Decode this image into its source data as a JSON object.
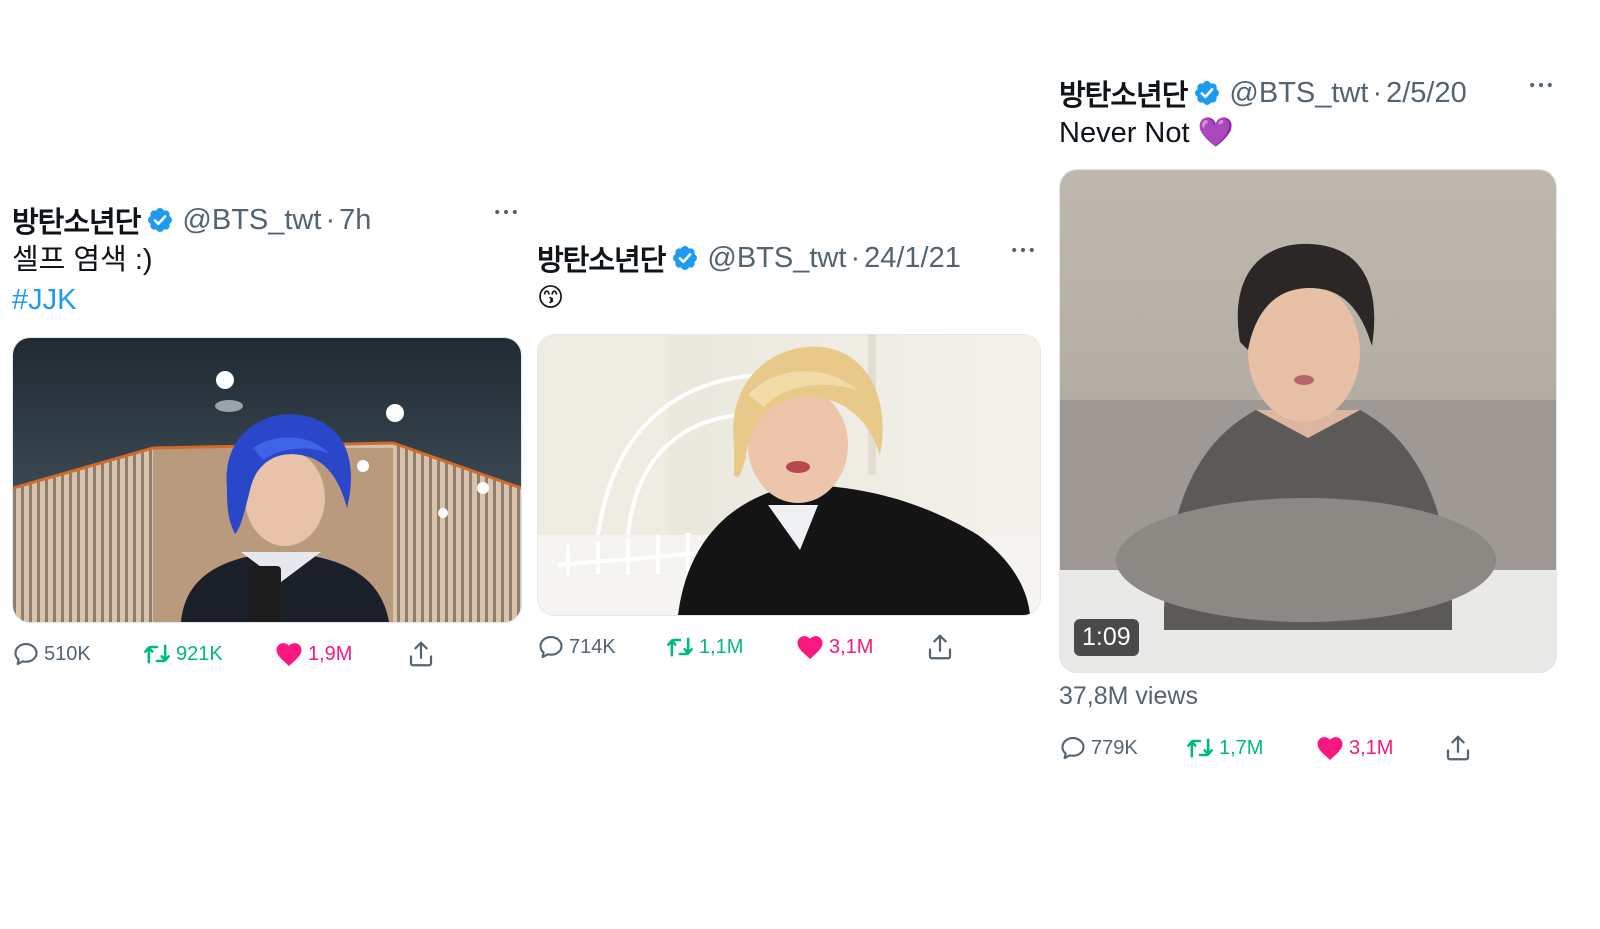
{
  "colors": {
    "text": "#0f1419",
    "secondary": "#536471",
    "link": "#1d9bf0",
    "verified": "#1d9bf0",
    "retweet": "#00ba7c",
    "like": "#f91880"
  },
  "tweets": [
    {
      "name": "방탄소년단",
      "handle": "@BTS_twt",
      "separator": "·",
      "date": "7h",
      "text": "셀프 염색 :)",
      "hashtag": "#JJK",
      "media_type": "photo",
      "media_description": "selfie in mirror, blue hair, studio ceiling lights",
      "replies": "510K",
      "retweets": "921K",
      "likes": "1,9M"
    },
    {
      "name": "방탄소년단",
      "handle": "@BTS_twt",
      "separator": "·",
      "date": "24/1/21",
      "text": "😙",
      "media_type": "photo",
      "media_description": "selfie on white bed, blonde hair, black jacket",
      "replies": "714K",
      "retweets": "1,1M",
      "likes": "3,1M"
    },
    {
      "name": "방탄소년단",
      "handle": "@BTS_twt",
      "separator": "·",
      "date": "2/5/20",
      "text": "Never Not 💜",
      "media_type": "video",
      "media_description": "singing on bed, grey t-shirt",
      "duration": "1:09",
      "views": "37,8M views",
      "replies": "779K",
      "retweets": "1,7M",
      "likes": "3,1M"
    }
  ],
  "icons": {
    "verified": "verified-badge-icon",
    "more": "more-options-icon",
    "reply": "reply-icon",
    "retweet": "retweet-icon",
    "like": "heart-icon",
    "share": "share-icon"
  }
}
